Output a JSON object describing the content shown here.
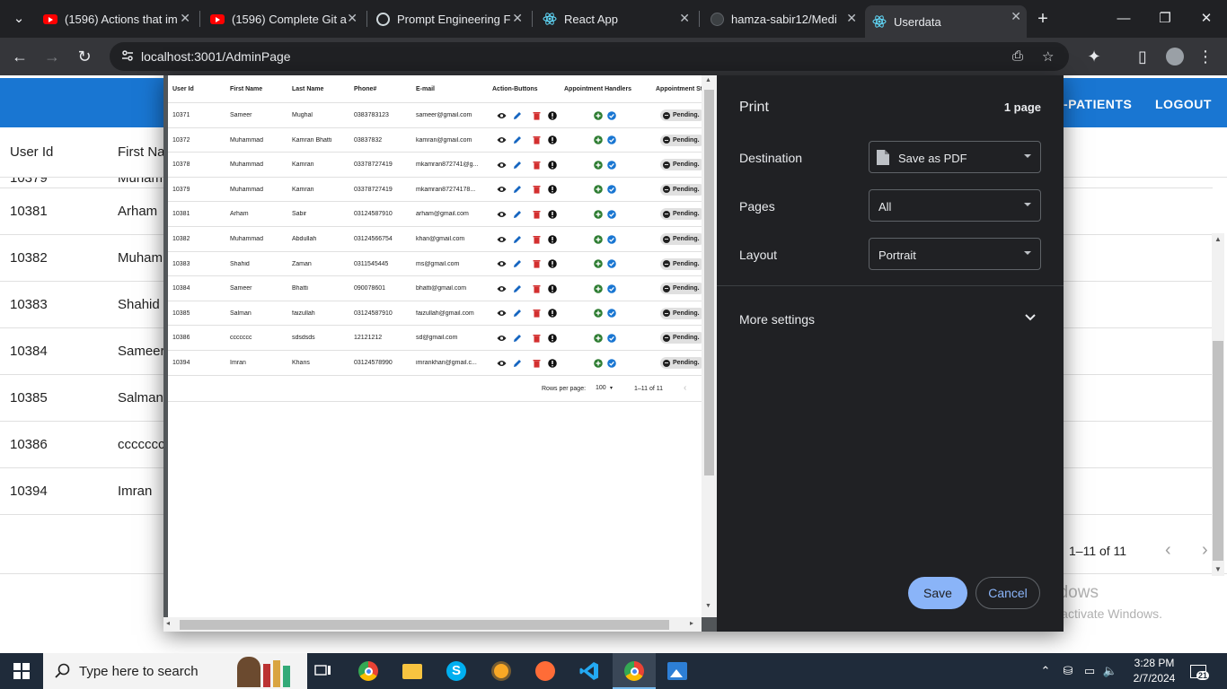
{
  "browser": {
    "tabs": [
      {
        "title": "(1596) Actions that im",
        "icon": "youtube-icon"
      },
      {
        "title": "(1596) Complete Git a",
        "icon": "youtube-icon"
      },
      {
        "title": "Prompt Engineering F",
        "icon": "chatgpt-icon"
      },
      {
        "title": "React App",
        "icon": "react-icon"
      },
      {
        "title": "hamza-sabir12/Medi",
        "icon": "github-icon"
      },
      {
        "title": "Userdata",
        "icon": "react-icon",
        "active": true
      }
    ],
    "url": "localhost:3001/AdminPage"
  },
  "app": {
    "nav": {
      "patients": "-PATIENTS",
      "logout": "LOGOUT"
    },
    "table": {
      "headers": [
        "User Id",
        "First Na"
      ],
      "partial_row": [
        "10379",
        "Muhamm"
      ],
      "rows": [
        [
          "10381",
          "Arham"
        ],
        [
          "10382",
          "Muhamm"
        ],
        [
          "10383",
          "Shahid"
        ],
        [
          "10384",
          "Sameer"
        ],
        [
          "10385",
          "Salman"
        ],
        [
          "10386",
          "ccccccc"
        ],
        [
          "10394",
          "Imran"
        ]
      ],
      "pagination": "1–11 of 11"
    }
  },
  "print_preview": {
    "headers": [
      "User Id",
      "First Name",
      "Last Name",
      "Phone#",
      "E-mail",
      "Action-Buttons",
      "Appointment Handlers",
      "Appointment St"
    ],
    "rows": [
      {
        "id": "10371",
        "first": "Sameer",
        "last": "Mughal",
        "phone": "0383783123",
        "email": "sameer@gmail.com",
        "status": "Pending."
      },
      {
        "id": "10372",
        "first": "Muhammad",
        "last": "Kamran Bhatti",
        "phone": "03837832",
        "email": "kamran@gmail.com",
        "status": "Pending."
      },
      {
        "id": "10378",
        "first": "Muhammad",
        "last": "Kamran",
        "phone": "03378727419",
        "email": "mkamran872741@g...",
        "status": "Pending."
      },
      {
        "id": "10379",
        "first": "Muhammad",
        "last": "Kamran",
        "phone": "03378727419",
        "email": "mkamran87274178...",
        "status": "Pending."
      },
      {
        "id": "10381",
        "first": "Arham",
        "last": "Sabir",
        "phone": "03124587910",
        "email": "arham@gmail.com",
        "status": "Pending."
      },
      {
        "id": "10382",
        "first": "Muhammad",
        "last": "Abdullah",
        "phone": "03124566754",
        "email": "khan@gmail.com",
        "status": "Pending."
      },
      {
        "id": "10383",
        "first": "Shahid",
        "last": "Zaman",
        "phone": "0311545445",
        "email": "ms@gmail.com",
        "status": "Pending."
      },
      {
        "id": "10384",
        "first": "Sameer",
        "last": "Bhatti",
        "phone": "090078601",
        "email": "bhatti@gmail.com",
        "status": "Pending."
      },
      {
        "id": "10385",
        "first": "Salman",
        "last": "faizullah",
        "phone": "03124587910",
        "email": "faizullah@gmail.com",
        "status": "Pending."
      },
      {
        "id": "10386",
        "first": "ccccccc",
        "last": "sdsdsds",
        "phone": "12121212",
        "email": "sd@gmail.com",
        "status": "Pending."
      },
      {
        "id": "10394",
        "first": "Imran",
        "last": "Khans",
        "phone": "03124578990",
        "email": "imrankhan@gmail.c...",
        "status": "Pending."
      }
    ],
    "rows_per_page_label": "Rows per page:",
    "rows_per_page": "100",
    "range": "1–11 of 11"
  },
  "print_settings": {
    "title": "Print",
    "page_count": "1 page",
    "destination_label": "Destination",
    "destination": "Save as PDF",
    "pages_label": "Pages",
    "pages": "All",
    "layout_label": "Layout",
    "layout": "Portrait",
    "more_settings": "More settings",
    "save": "Save",
    "cancel": "Cancel"
  },
  "watermark": {
    "line1": "Activate Windows",
    "line2": "Go to Settings to activate Windows."
  },
  "taskbar": {
    "search_placeholder": "Type here to search",
    "time": "3:28 PM",
    "date": "2/7/2024",
    "notifications": "21"
  },
  "colors": {
    "appbar": "#1976d2",
    "add": "#2e7d32",
    "check": "#1976d2",
    "delete": "#d32f2f",
    "edit": "#1565c0"
  }
}
